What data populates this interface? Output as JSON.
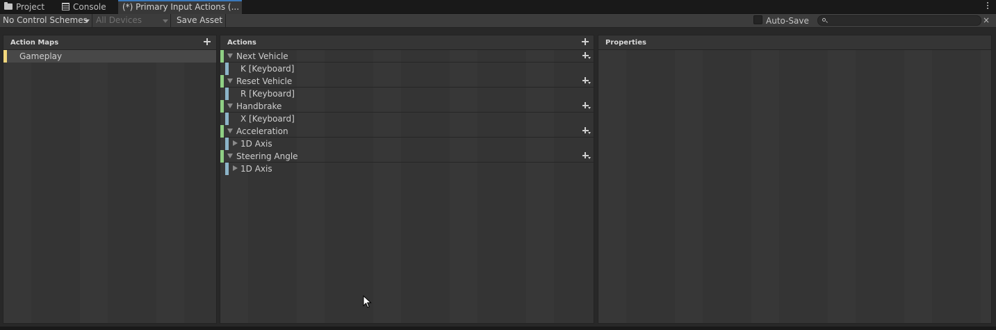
{
  "tabs": [
    {
      "label": "Project",
      "icon": "folder-icon"
    },
    {
      "label": "Console",
      "icon": "console-icon"
    },
    {
      "label": "(*) Primary Input Actions (..."
    }
  ],
  "toolbar": {
    "control_schemes": "No Control Schemes",
    "devices": "All Devices",
    "save_asset": "Save Asset",
    "auto_save_label": "Auto-Save",
    "auto_save_checked": false,
    "search_placeholder": "",
    "clear_glyph": "×"
  },
  "action_maps": {
    "header": "Action Maps",
    "items": [
      {
        "label": "Gameplay",
        "selected": true
      }
    ]
  },
  "actions": {
    "header": "Actions",
    "items": [
      {
        "label": "Next Vehicle",
        "bindings": [
          {
            "label": "K [Keyboard]",
            "composite": false
          }
        ]
      },
      {
        "label": "Reset Vehicle",
        "bindings": [
          {
            "label": "R [Keyboard]",
            "composite": false
          }
        ]
      },
      {
        "label": "Handbrake",
        "bindings": [
          {
            "label": "X [Keyboard]",
            "composite": false
          }
        ]
      },
      {
        "label": "Acceleration",
        "bindings": [
          {
            "label": "1D Axis",
            "composite": true
          }
        ]
      },
      {
        "label": "Steering Angle",
        "bindings": [
          {
            "label": "1D Axis",
            "composite": true
          }
        ]
      }
    ]
  },
  "properties": {
    "header": "Properties"
  },
  "colors": {
    "action_map_marker": "#f2d77c",
    "action_marker": "#8fcf84",
    "binding_marker": "#8cb4c8",
    "active_tab_accent": "#3a79bb"
  }
}
